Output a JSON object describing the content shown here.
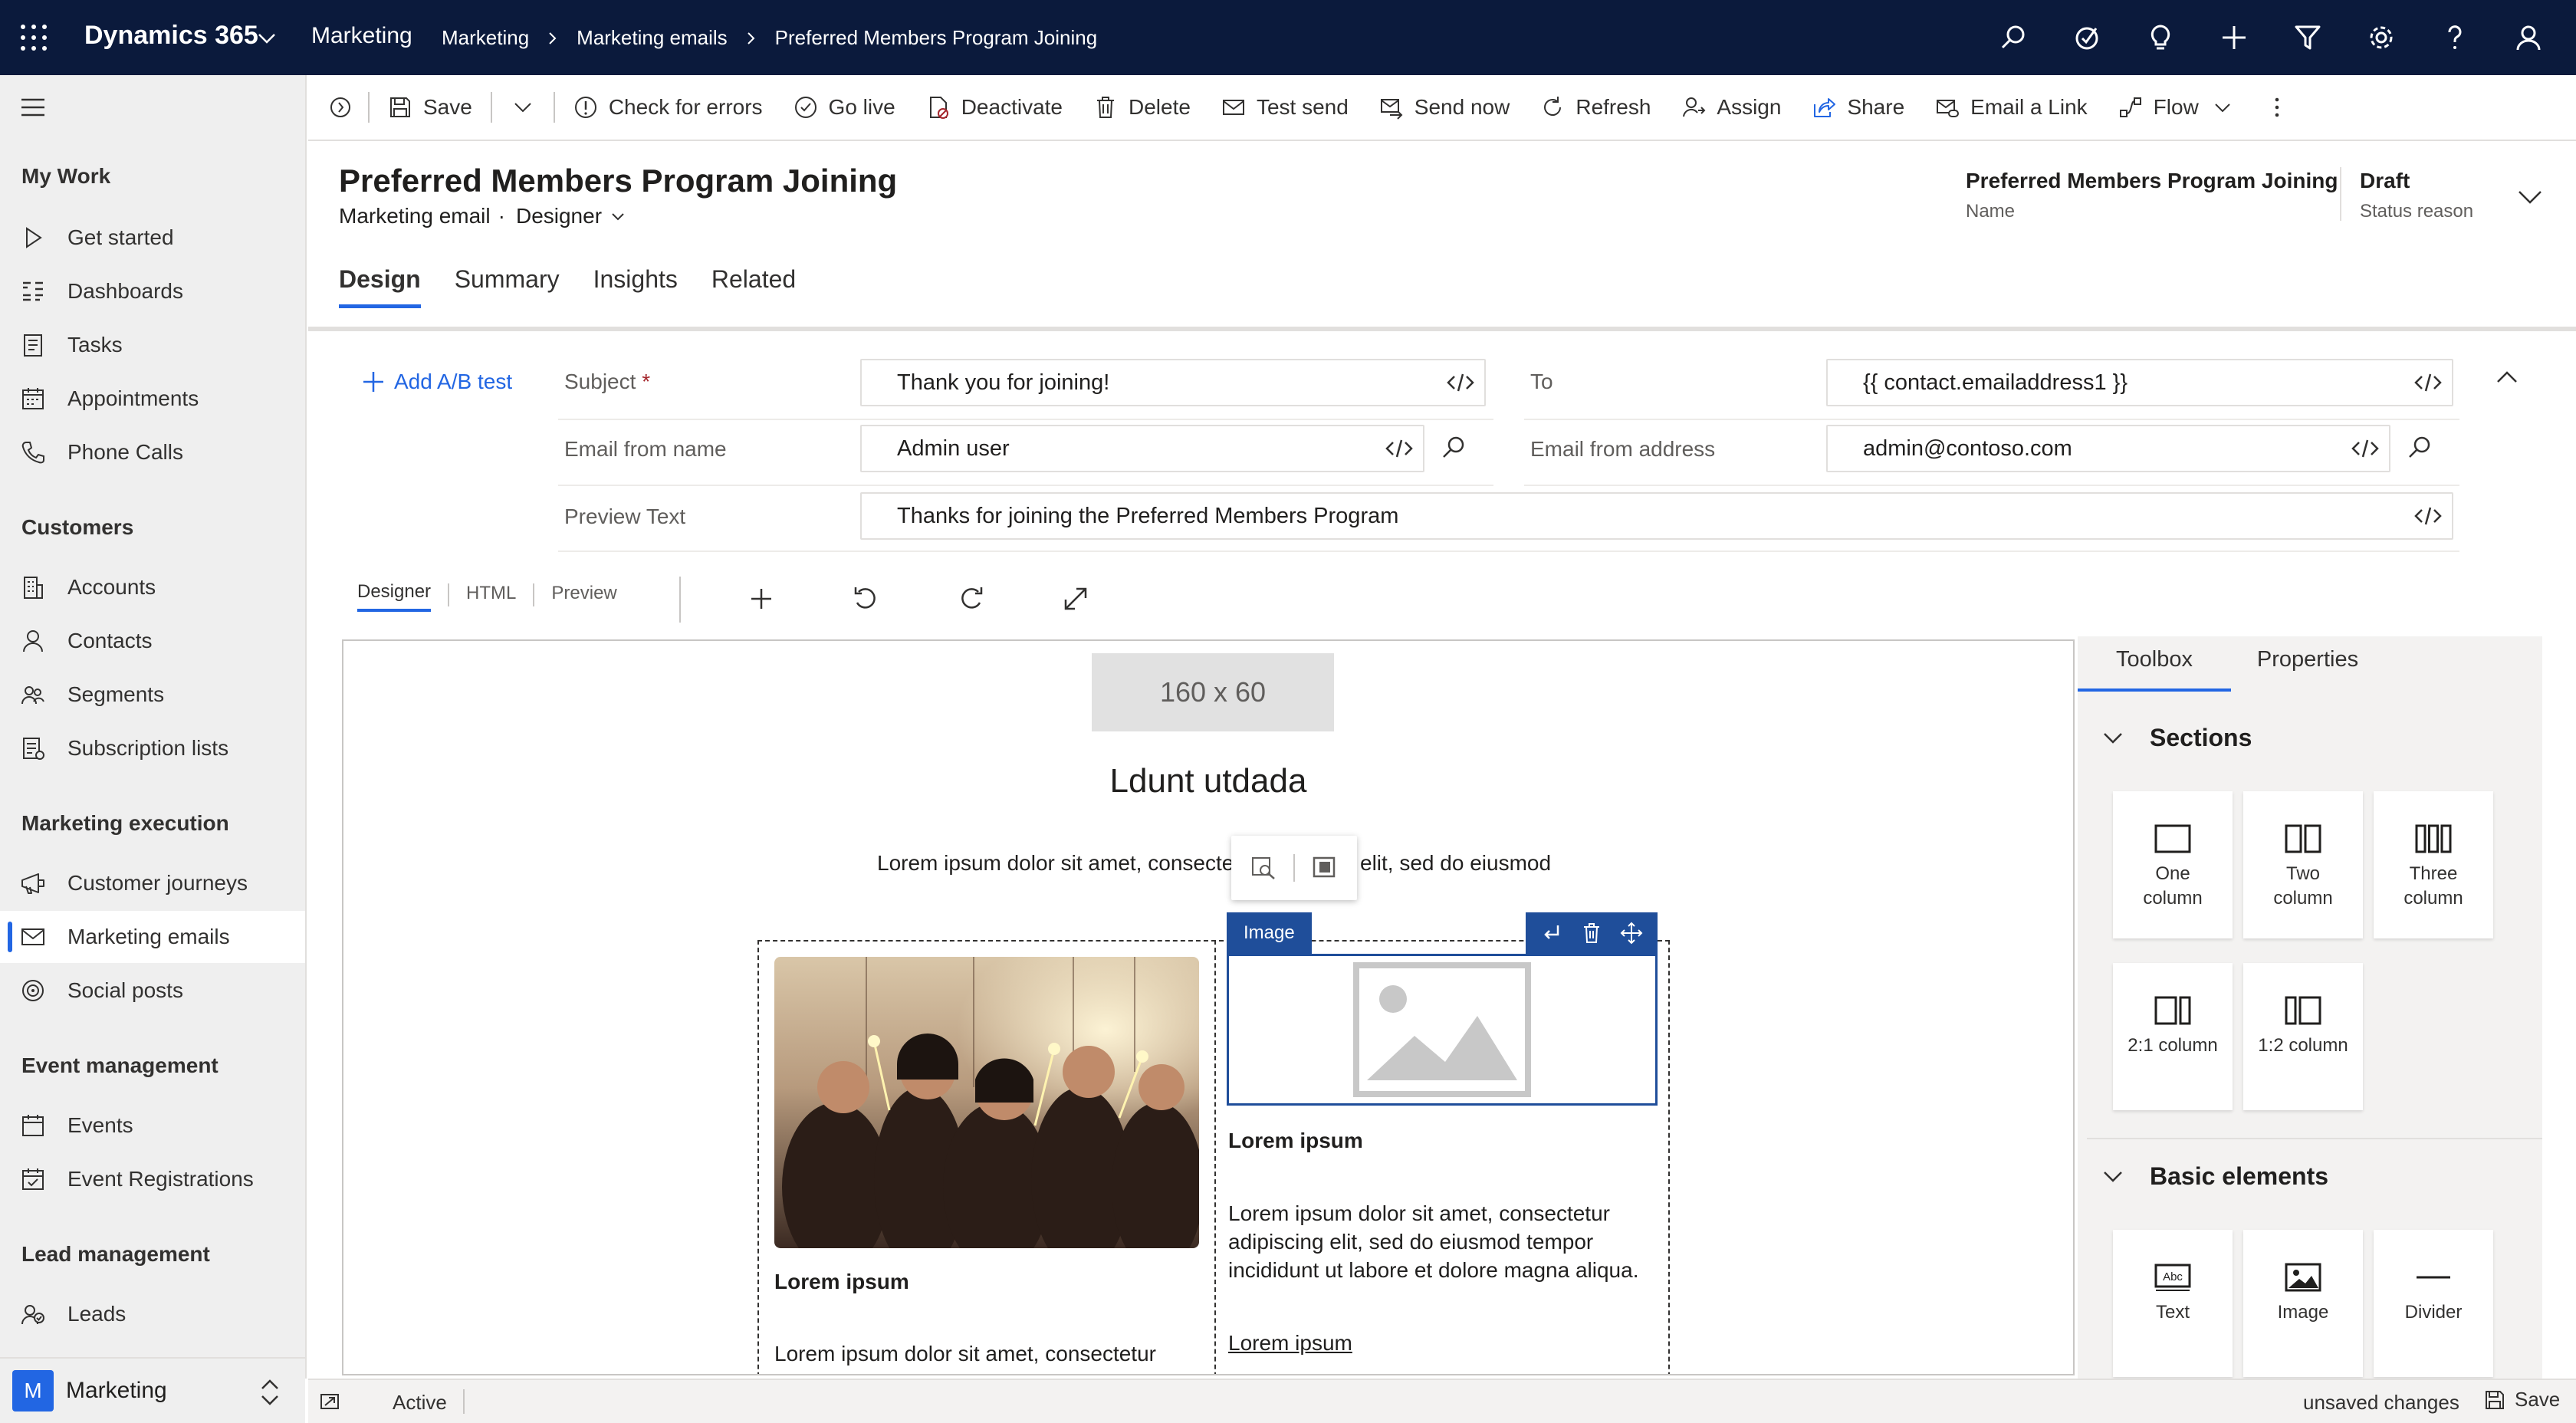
{
  "top_nav": {
    "brand": "Dynamics 365",
    "app_name": "Marketing",
    "breadcrumbs": [
      "Marketing",
      "Marketing emails",
      "Preferred Members Program Joining"
    ],
    "icons": [
      "search-icon",
      "task-icon",
      "lightbulb-icon",
      "plus-icon",
      "filter-icon",
      "settings-icon",
      "help-icon",
      "user-icon"
    ]
  },
  "sidebar": {
    "groups": [
      {
        "title": "My Work",
        "items": [
          {
            "label": "Get started",
            "icon": "play-icon"
          },
          {
            "label": "Dashboards",
            "icon": "dashboard-icon"
          },
          {
            "label": "Tasks",
            "icon": "tasks-icon"
          },
          {
            "label": "Appointments",
            "icon": "calendar-icon"
          },
          {
            "label": "Phone Calls",
            "icon": "phone-icon"
          }
        ]
      },
      {
        "title": "Customers",
        "items": [
          {
            "label": "Accounts",
            "icon": "building-icon"
          },
          {
            "label": "Contacts",
            "icon": "contact-icon"
          },
          {
            "label": "Segments",
            "icon": "segments-icon"
          },
          {
            "label": "Subscription lists",
            "icon": "list-icon"
          }
        ]
      },
      {
        "title": "Marketing execution",
        "items": [
          {
            "label": "Customer journeys",
            "icon": "journey-icon"
          },
          {
            "label": "Marketing emails",
            "icon": "mail-icon",
            "active": true
          },
          {
            "label": "Social posts",
            "icon": "social-icon"
          }
        ]
      },
      {
        "title": "Event management",
        "items": [
          {
            "label": "Events",
            "icon": "event-icon"
          },
          {
            "label": "Event Registrations",
            "icon": "registration-icon"
          }
        ]
      },
      {
        "title": "Lead management",
        "items": [
          {
            "label": "Leads",
            "icon": "leads-icon"
          }
        ]
      }
    ],
    "area_switcher": {
      "badge": "M",
      "label": "Marketing"
    }
  },
  "command_bar": {
    "save": "Save",
    "check_errors": "Check for errors",
    "go_live": "Go live",
    "deactivate": "Deactivate",
    "delete": "Delete",
    "test_send": "Test send",
    "send_now": "Send now",
    "refresh": "Refresh",
    "assign": "Assign",
    "share": "Share",
    "email_link": "Email a Link",
    "flow": "Flow"
  },
  "header": {
    "title": "Preferred Members Program Joining",
    "entity": "Marketing email",
    "form_selector": "Designer",
    "name_value": "Preferred Members Program Joining",
    "name_label": "Name",
    "status_value": "Draft",
    "status_label": "Status reason",
    "tabs": [
      "Design",
      "Summary",
      "Insights",
      "Related"
    ],
    "active_tab": "Design"
  },
  "email_fields": {
    "add_ab_test": "Add A/B test",
    "subject_label": "Subject",
    "subject_required": "*",
    "subject_value": "Thank you for joining!",
    "to_label": "To",
    "to_value": "{{ contact.emailaddress1 }}",
    "from_name_label": "Email from name",
    "from_name_value": "Admin user",
    "from_address_label": "Email from address",
    "from_address_value": "admin@contoso.com",
    "preview_label": "Preview Text",
    "preview_value": "Thanks for joining the Preferred Members Program"
  },
  "designer": {
    "tabs": [
      "Designer",
      "HTML",
      "Preview"
    ],
    "active_tab": "Designer",
    "tools": [
      "plus-icon",
      "undo-icon",
      "redo-icon",
      "expand-icon"
    ]
  },
  "canvas": {
    "logo_placeholder": "160 x 60",
    "heading": "Ldunt utdada",
    "intro_left": "Lorem ipsum dolor sit amet, consecte",
    "intro_right": "elit, sed do eiusmod",
    "image_badge": "Image",
    "left_col": {
      "title": "Lorem ipsum",
      "body": "Lorem ipsum dolor sit amet, consectetur"
    },
    "right_col": {
      "title": "Lorem ipsum",
      "body": "Lorem ipsum dolor sit amet, consectetur adipiscing elit, sed do eiusmod tempor incididunt ut labore et dolore magna aliqua.",
      "link": "Lorem ipsum"
    }
  },
  "toolbox": {
    "tabs": [
      "Toolbox",
      "Properties"
    ],
    "active_tab": "Toolbox",
    "sections_title": "Sections",
    "sections": [
      "One column",
      "Two column",
      "Three column",
      "2:1 column",
      "1:2 column"
    ],
    "basic_title": "Basic elements",
    "basic": [
      "Text",
      "Image",
      "Divider"
    ]
  },
  "status_bar": {
    "state": "Active",
    "unsaved": "unsaved changes",
    "save": "Save"
  },
  "colors": {
    "nav_bg": "#0b1a3c",
    "accent": "#2266e3",
    "selection": "#1f4e9a",
    "required": "#a4262c"
  }
}
